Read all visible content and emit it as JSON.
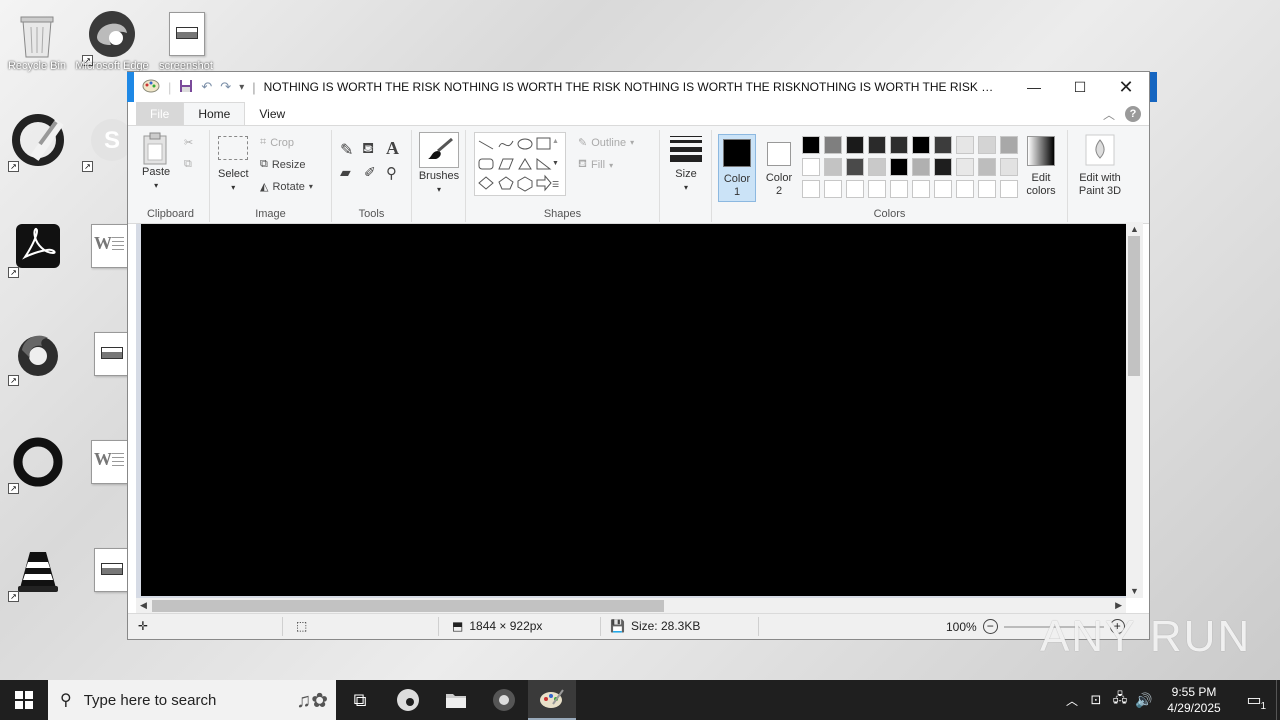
{
  "desktop": {
    "icons": [
      {
        "name": "recycle-bin",
        "label": "Recycle Bin"
      },
      {
        "name": "edge",
        "label": "Microsoft Edge"
      },
      {
        "name": "image-file",
        "label": "screenshot"
      },
      {
        "name": "ccleaner",
        "label": "CCleaner"
      },
      {
        "name": "skype",
        "label": "Skype"
      },
      {
        "name": "acrobat",
        "label": "Acrobat Reader DC"
      },
      {
        "name": "word-doc-1",
        "label": ""
      },
      {
        "name": "firefox",
        "label": "Firefox"
      },
      {
        "name": "image-file-2",
        "label": ""
      },
      {
        "name": "opera",
        "label": "Opera"
      },
      {
        "name": "word-doc-2",
        "label": ""
      },
      {
        "name": "vlc",
        "label": "VLC media player"
      },
      {
        "name": "image-file-3",
        "label": ""
      }
    ]
  },
  "window": {
    "title": "NOTHING IS WORTH THE RISK NOTHING IS WORTH THE RISK NOTHING IS WORTH THE RISKNOTHING IS WORTH THE RISK NOTHING IS W...",
    "tabs": {
      "file": "File",
      "home": "Home",
      "view": "View"
    },
    "ribbon": {
      "clipboard": {
        "label": "Clipboard",
        "paste": "Paste"
      },
      "image": {
        "label": "Image",
        "select": "Select",
        "crop": "Crop",
        "resize": "Resize",
        "rotate": "Rotate"
      },
      "tools": {
        "label": "Tools"
      },
      "brushes": "Brushes",
      "shapes": {
        "label": "Shapes",
        "outline": "Outline",
        "fill": "Fill"
      },
      "size": "Size",
      "colors": {
        "label": "Colors",
        "color1": "Color 1",
        "color2": "Color 2",
        "edit": "Edit colors",
        "color1_value": "#000000",
        "color2_value": "#ffffff",
        "palette_row1": [
          "#000000",
          "#7f7f7f",
          "#1a1a1a",
          "#2a2a2a",
          "#2e2e2e",
          "#000000",
          "#3c3c3c",
          "#e6e6e6",
          "#d4d4d4",
          "#a8a8a8"
        ],
        "palette_row2": [
          "#ffffff",
          "#c3c3c3",
          "#4a4a4a",
          "#c9c9c9",
          "#000000",
          "#b0b0b0",
          "#1e1e1e",
          "#e8e8e8",
          "#bdbdbd",
          "#e2e2e2"
        ],
        "palette_row3": [
          "#ffffff",
          "#ffffff",
          "#ffffff",
          "#ffffff",
          "#ffffff",
          "#ffffff",
          "#ffffff",
          "#ffffff",
          "#ffffff",
          "#ffffff"
        ]
      },
      "paint3d": "Edit with Paint 3D"
    },
    "status": {
      "dimensions": "1844 × 922px",
      "size": "Size: 28.3KB",
      "zoom": "100%"
    }
  },
  "taskbar": {
    "search_placeholder": "Type here to search",
    "time": "9:55 PM",
    "date": "4/29/2025",
    "notification_count": "1"
  },
  "watermark": "ANY RUN"
}
